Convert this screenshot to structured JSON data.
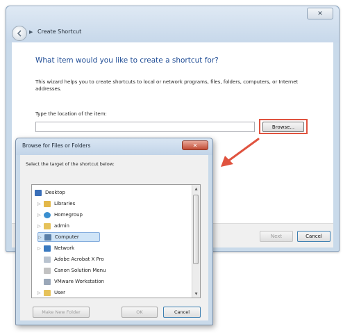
{
  "wizard": {
    "title": "Create Shortcut",
    "close_label": "✕",
    "heading": "What item would you like to create a shortcut for?",
    "description": "This wizard helps you to create shortcuts to local or network programs, files, folders, computers, or Internet addresses.",
    "location_label": "Type the location of the item:",
    "location_value": "",
    "browse_label": "Browse...",
    "next_label": "Next",
    "cancel_label": "Cancel"
  },
  "browse_dialog": {
    "title": "Browse for Files or Folders",
    "close_label": "✕",
    "instruction": "Select the target of the shortcut below:",
    "tree_items": [
      {
        "label": "Desktop",
        "icon": "desktop-icon",
        "color": "#3a6fb8"
      },
      {
        "label": "Libraries",
        "icon": "libraries-icon",
        "color": "#e3b84a"
      },
      {
        "label": "Homegroup",
        "icon": "homegroup-icon",
        "color": "#3a8fd0"
      },
      {
        "label": "admin",
        "icon": "user-folder-icon",
        "color": "#e6c25a"
      },
      {
        "label": "Computer",
        "icon": "computer-icon",
        "color": "#5a7fa8"
      },
      {
        "label": "Network",
        "icon": "network-icon",
        "color": "#3a7ac0"
      },
      {
        "label": "Adobe Acrobat X Pro",
        "icon": "shortcut-icon",
        "color": "#b9c3cf"
      },
      {
        "label": "Canon Solution Menu",
        "icon": "shortcut-icon",
        "color": "#c2c2c2"
      },
      {
        "label": "VMware Workstation",
        "icon": "shortcut-icon",
        "color": "#9aa7b8"
      },
      {
        "label": "User",
        "icon": "folder-icon",
        "color": "#e6c25a"
      }
    ],
    "selected_item": "Computer",
    "new_folder_label": "Make New Folder",
    "ok_label": "OK",
    "cancel_label": "Cancel"
  },
  "colors": {
    "highlight_red": "#e0533f",
    "heading_blue": "#1f4c95"
  }
}
